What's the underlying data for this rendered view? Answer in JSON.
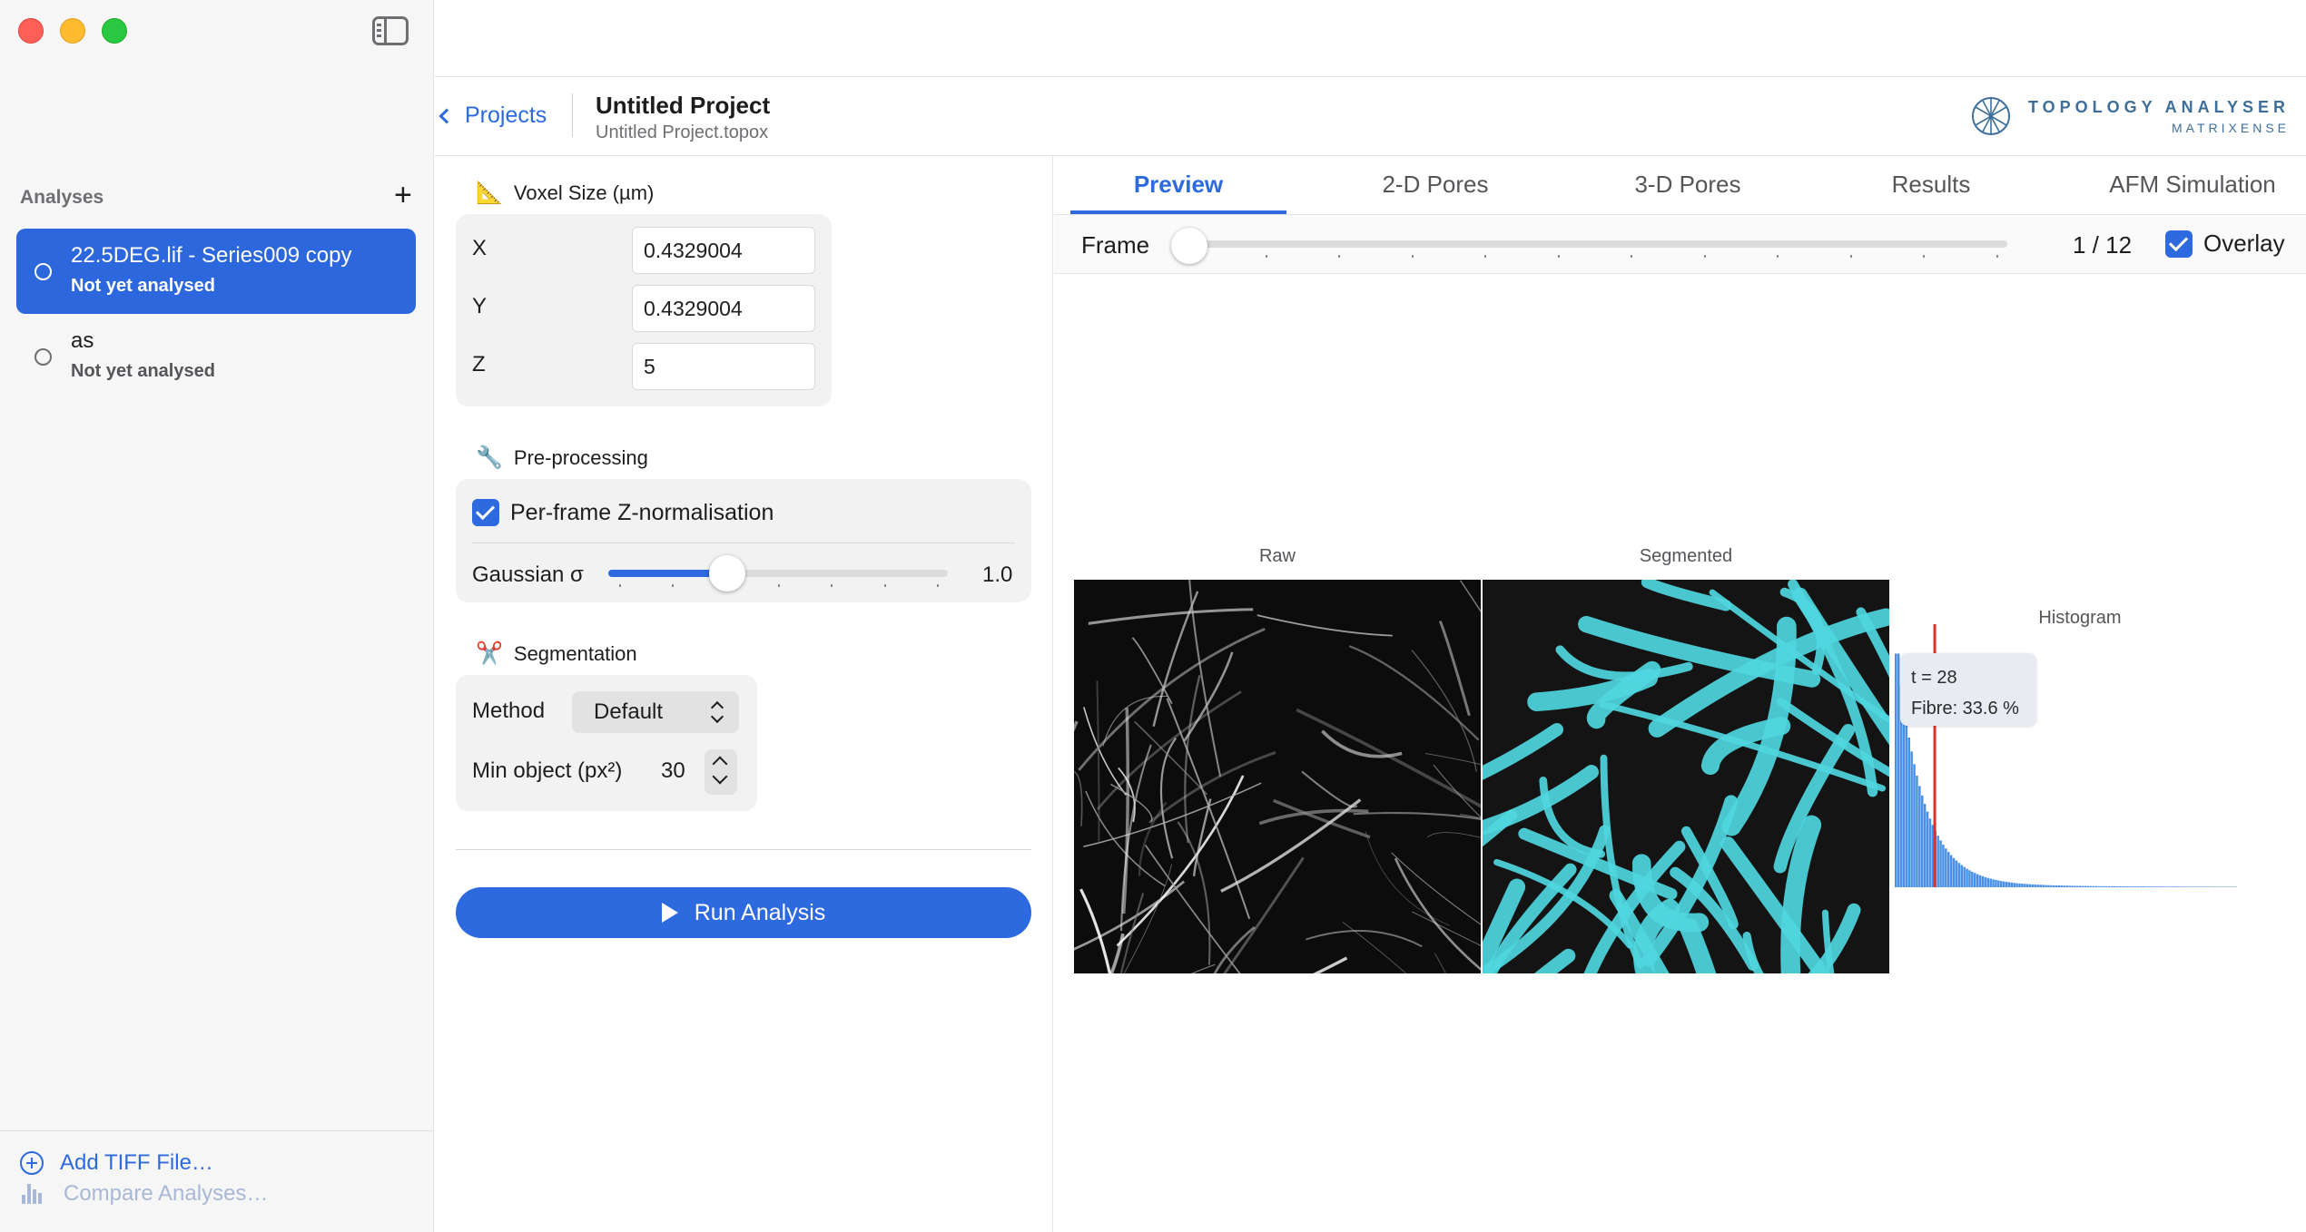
{
  "window": {
    "traffic_lights": [
      "close",
      "minimize",
      "zoom"
    ]
  },
  "sidebar": {
    "header": "Analyses",
    "add_symbol": "+",
    "items": [
      {
        "title": "22.5DEG.lif - Series009 copy",
        "subtitle": "Not yet analysed",
        "selected": true
      },
      {
        "title": "as",
        "subtitle": "Not yet analysed",
        "selected": false
      }
    ],
    "footer": {
      "add_tiff": "Add TIFF File…",
      "compare": "Compare Analyses…"
    }
  },
  "topbar": {
    "back_label": "Projects",
    "project_title": "Untitled Project",
    "project_file": "Untitled Project.topox",
    "brand_name": "TOPOLOGY ANALYSER",
    "brand_sub": "MATRIXENSE"
  },
  "settings": {
    "voxel": {
      "label": "Voxel Size (µm)",
      "icon": "📐",
      "x_label": "X",
      "x_value": "0.4329004",
      "y_label": "Y",
      "y_value": "0.4329004",
      "z_label": "Z",
      "z_value": "5"
    },
    "preprocessing": {
      "label": "Pre-processing",
      "icon": "🔧",
      "znorm_label": "Per-frame Z-normalisation",
      "znorm_checked": true,
      "gaussian_label": "Gaussian σ",
      "gaussian_value": "1.0",
      "gaussian_fraction": 0.35
    },
    "segmentation": {
      "label": "Segmentation",
      "icon": "✂️",
      "method_label": "Method",
      "method_value": "Default",
      "min_object_label": "Min object (px²)",
      "min_object_value": "30"
    },
    "run_label": "Run Analysis"
  },
  "preview": {
    "tabs": [
      {
        "label": "Preview",
        "active": true
      },
      {
        "label": "2-D Pores",
        "active": false
      },
      {
        "label": "3-D Pores",
        "active": false
      },
      {
        "label": "Results",
        "active": false
      },
      {
        "label": "AFM Simulation",
        "active": false
      }
    ],
    "frame_label": "Frame",
    "frame_count": "1 / 12",
    "frame_fraction": 0.0,
    "overlay_label": "Overlay",
    "overlay_checked": true,
    "raw_label": "Raw",
    "segmented_label": "Segmented",
    "histogram_label": "Histogram",
    "tooltip_t": "t = 28",
    "tooltip_fibre": "Fibre: 33.6 %",
    "threshold_t": 28
  },
  "colors": {
    "accent": "#2d6adf",
    "selection": "#2c67de",
    "overlay": "#4fd6e0",
    "histogram_bar": "#4a90e8",
    "threshold_line": "#e0302a"
  }
}
